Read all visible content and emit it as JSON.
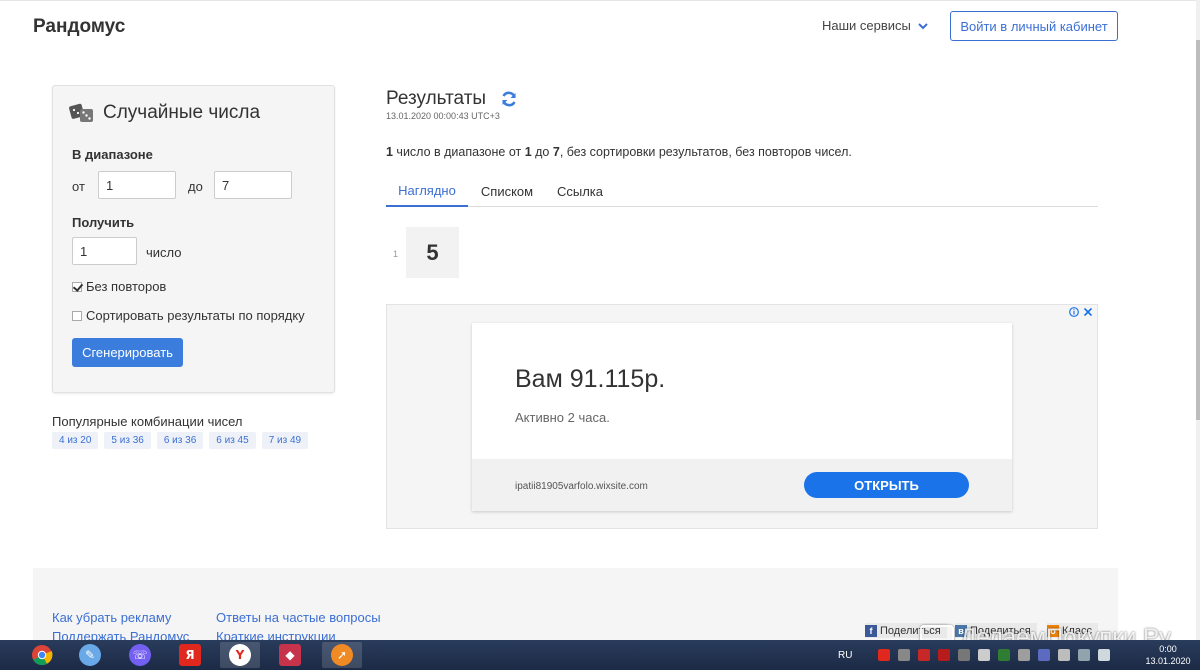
{
  "header": {
    "brand": "Рандомус",
    "services_label": "Наши сервисы",
    "login_label": "Войти в личный кабинет"
  },
  "form": {
    "title": "Случайные числа",
    "range_label": "В диапазоне",
    "from_label": "от",
    "from_value": "1",
    "to_label": "до",
    "to_value": "7",
    "get_label": "Получить",
    "count_value": "1",
    "count_unit": "число",
    "no_repeat_label": "Без повторов",
    "no_repeat_checked": true,
    "sort_label": "Сортировать результаты по порядку",
    "sort_checked": false,
    "generate_label": "Сгенерировать"
  },
  "popular": {
    "title": "Популярные комбинации чисел",
    "items": [
      "4 из 20",
      "5 из 36",
      "6 из 36",
      "6 из 45",
      "7 из 49"
    ]
  },
  "results": {
    "title": "Результаты",
    "timestamp": "13.01.2020 00:00:43 UTC+3",
    "desc": {
      "count": "1",
      "p1": " число в диапазоне от ",
      "from": "1",
      "p2": " до ",
      "to": "7",
      "p3": ", без сортировки результатов, без повторов чисел."
    },
    "tabs": [
      "Наглядно",
      "Списком",
      "Ссылка"
    ],
    "active_tab": 0,
    "numbers": [
      {
        "index": "1",
        "value": "5"
      }
    ]
  },
  "ad": {
    "headline": "Вам 91.115р.",
    "subtext": "Активно 2 часа.",
    "site": "ipatii81905varfolo.wixsite.com",
    "cta": "ОТКРЫТЬ"
  },
  "footer": {
    "links_col1": [
      "Как убрать рекламу",
      "Поддержать Рандомус"
    ],
    "links_col2": [
      "Ответы на частые вопросы",
      "Краткие инструкции"
    ],
    "share": [
      {
        "label": "Поделиться",
        "icon": "facebook-icon",
        "color": "#3b5998"
      },
      {
        "label": "Поделиться",
        "icon": "vk-icon",
        "color": "#4a76a8"
      },
      {
        "label": "Класс",
        "icon": "odnoklassniki-icon",
        "color": "#ee8208"
      }
    ]
  },
  "watermark": "ДелаемПокупки.Ру",
  "taskbar": {
    "lang": "RU",
    "time": "0:00",
    "date": "13.01.2020"
  },
  "colors": {
    "accent": "#3b6fd4",
    "button": "#3b7ddd",
    "ad_button": "#1a73e8"
  }
}
